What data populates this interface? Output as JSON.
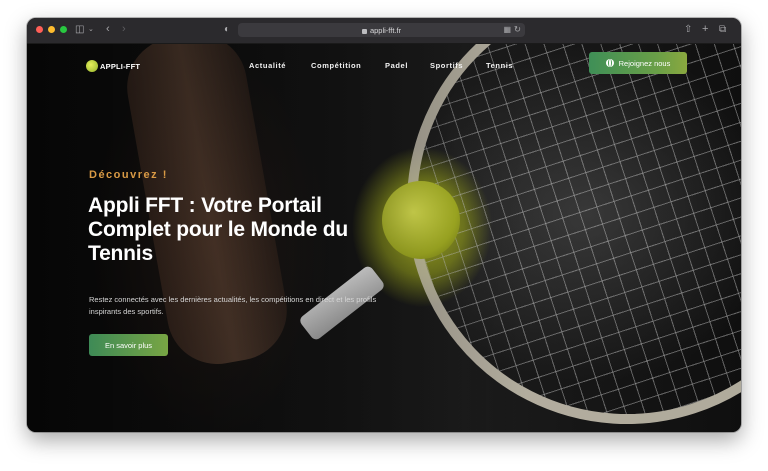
{
  "browser": {
    "url": "appli-fft.fr"
  },
  "site": {
    "logo_text": "APPLI-FFT",
    "nav": [
      "Actualité",
      "Compétition",
      "Padel",
      "Sportifs",
      "Tennis"
    ],
    "join_label": "Rejoignez nous"
  },
  "hero": {
    "eyebrow": "Découvrez !",
    "title": "Appli FFT : Votre Portail Complet pour le Monde du Tennis",
    "description": "Restez connectés avec les dernières actualités, les compétitions en direct et les profils inspirants des sportifs.",
    "cta_label": "En savoir plus"
  },
  "colors": {
    "accent_orange": "#d99a45",
    "button_green_start": "#3f8f57",
    "button_green_end": "#8aa83f",
    "toolbar": "#2b2a2d"
  }
}
